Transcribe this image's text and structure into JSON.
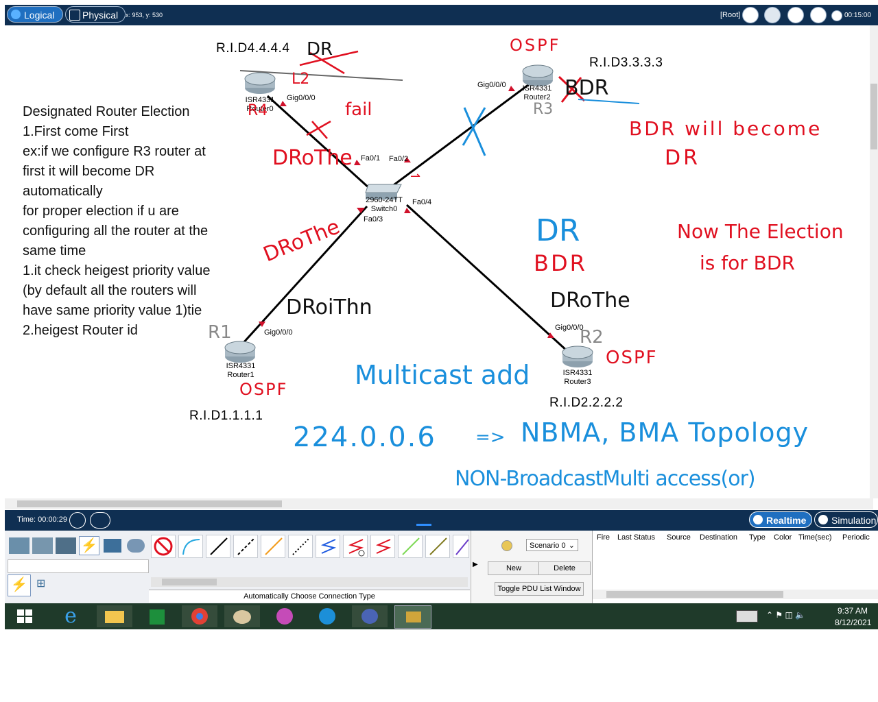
{
  "toolbar": {
    "logical_label": "Logical",
    "physical_label": "Physical",
    "coords": "x: 953, y: 530",
    "root_label": "[Root]",
    "clock": "00:15:00"
  },
  "workspace": {
    "rid_top": "R.I.D4.4.4.4",
    "rid_right": "R.I.D3.3.3.3",
    "rid_bottom_left": "R.I.D1.1.1.1",
    "rid_bottom_right": "R.I.D2.2.2.2",
    "notes": [
      "Designated Router Election",
      "1.First come First",
      "ex:if we configure R3 router at",
      "first it will become DR",
      "automatically",
      "for proper election if u are",
      "configuring all the router at the",
      "same time",
      "1.it check heigest priority value",
      "(by default all the routers will",
      "have same priority value 1)tie",
      "2.heigest Router id"
    ],
    "devices": {
      "router0": {
        "model": "ISR4331",
        "name": "Router0",
        "port": "Gig0/0/0"
      },
      "router2": {
        "model": "ISR4331",
        "name": "Router2",
        "port": "Gig0/0/0"
      },
      "router1": {
        "model": "ISR4331",
        "name": "Router1",
        "port": "Gig0/0/0"
      },
      "router3": {
        "model": "ISR4331",
        "name": "Router3",
        "port": "Gig0/0/0"
      },
      "switch0": {
        "model": "2960-24TT",
        "name": "Switch0",
        "ports": [
          "Fa0/1",
          "Fa0/2",
          "Fa0/3",
          "Fa0/4"
        ]
      }
    },
    "annotations": {
      "dr_crossed": "DR",
      "l2": "L2",
      "fail": "fail",
      "ospf_top": "OSPF",
      "bdr_right": "BDR",
      "r3": "R3",
      "r4": "R4",
      "drother_tl": "DRoThe",
      "arrow_mark": "⇀",
      "bdr_will": "BDR will become",
      "dr_line": "DR",
      "dr_blue": "DR",
      "bdr_red": "BDR",
      "now_election": "Now The Election",
      "for_bdr": "is for BDR",
      "drother_left": "DRoThe",
      "droithn": "DRoiThn",
      "drother_right": "DRoThe",
      "r1": "R1",
      "r2": "R2",
      "ospf_bl": "OSPF",
      "ospf_br": "OSPF",
      "multicast": "Multicast add",
      "ip": "224.0.0.6",
      "arrow": "=>",
      "nbma": "NBMA, BMA Topology",
      "nonb": "NON-BroadcastMulti access(or)"
    }
  },
  "timebar": {
    "time": "Time: 00:00:29",
    "realtime": "Realtime",
    "simulation": "Simulation"
  },
  "connections": {
    "auto_label": "Automatically Choose Connection Type"
  },
  "pdu": {
    "scenario": "Scenario 0",
    "new": "New",
    "delete": "Delete",
    "toggle": "Toggle PDU List Window",
    "columns": [
      "Fire",
      "Last Status",
      "Source",
      "Destination",
      "Type",
      "Color",
      "Time(sec)",
      "Periodic"
    ]
  },
  "taskbar": {
    "time": "9:37 AM",
    "date": "8/12/2021"
  }
}
